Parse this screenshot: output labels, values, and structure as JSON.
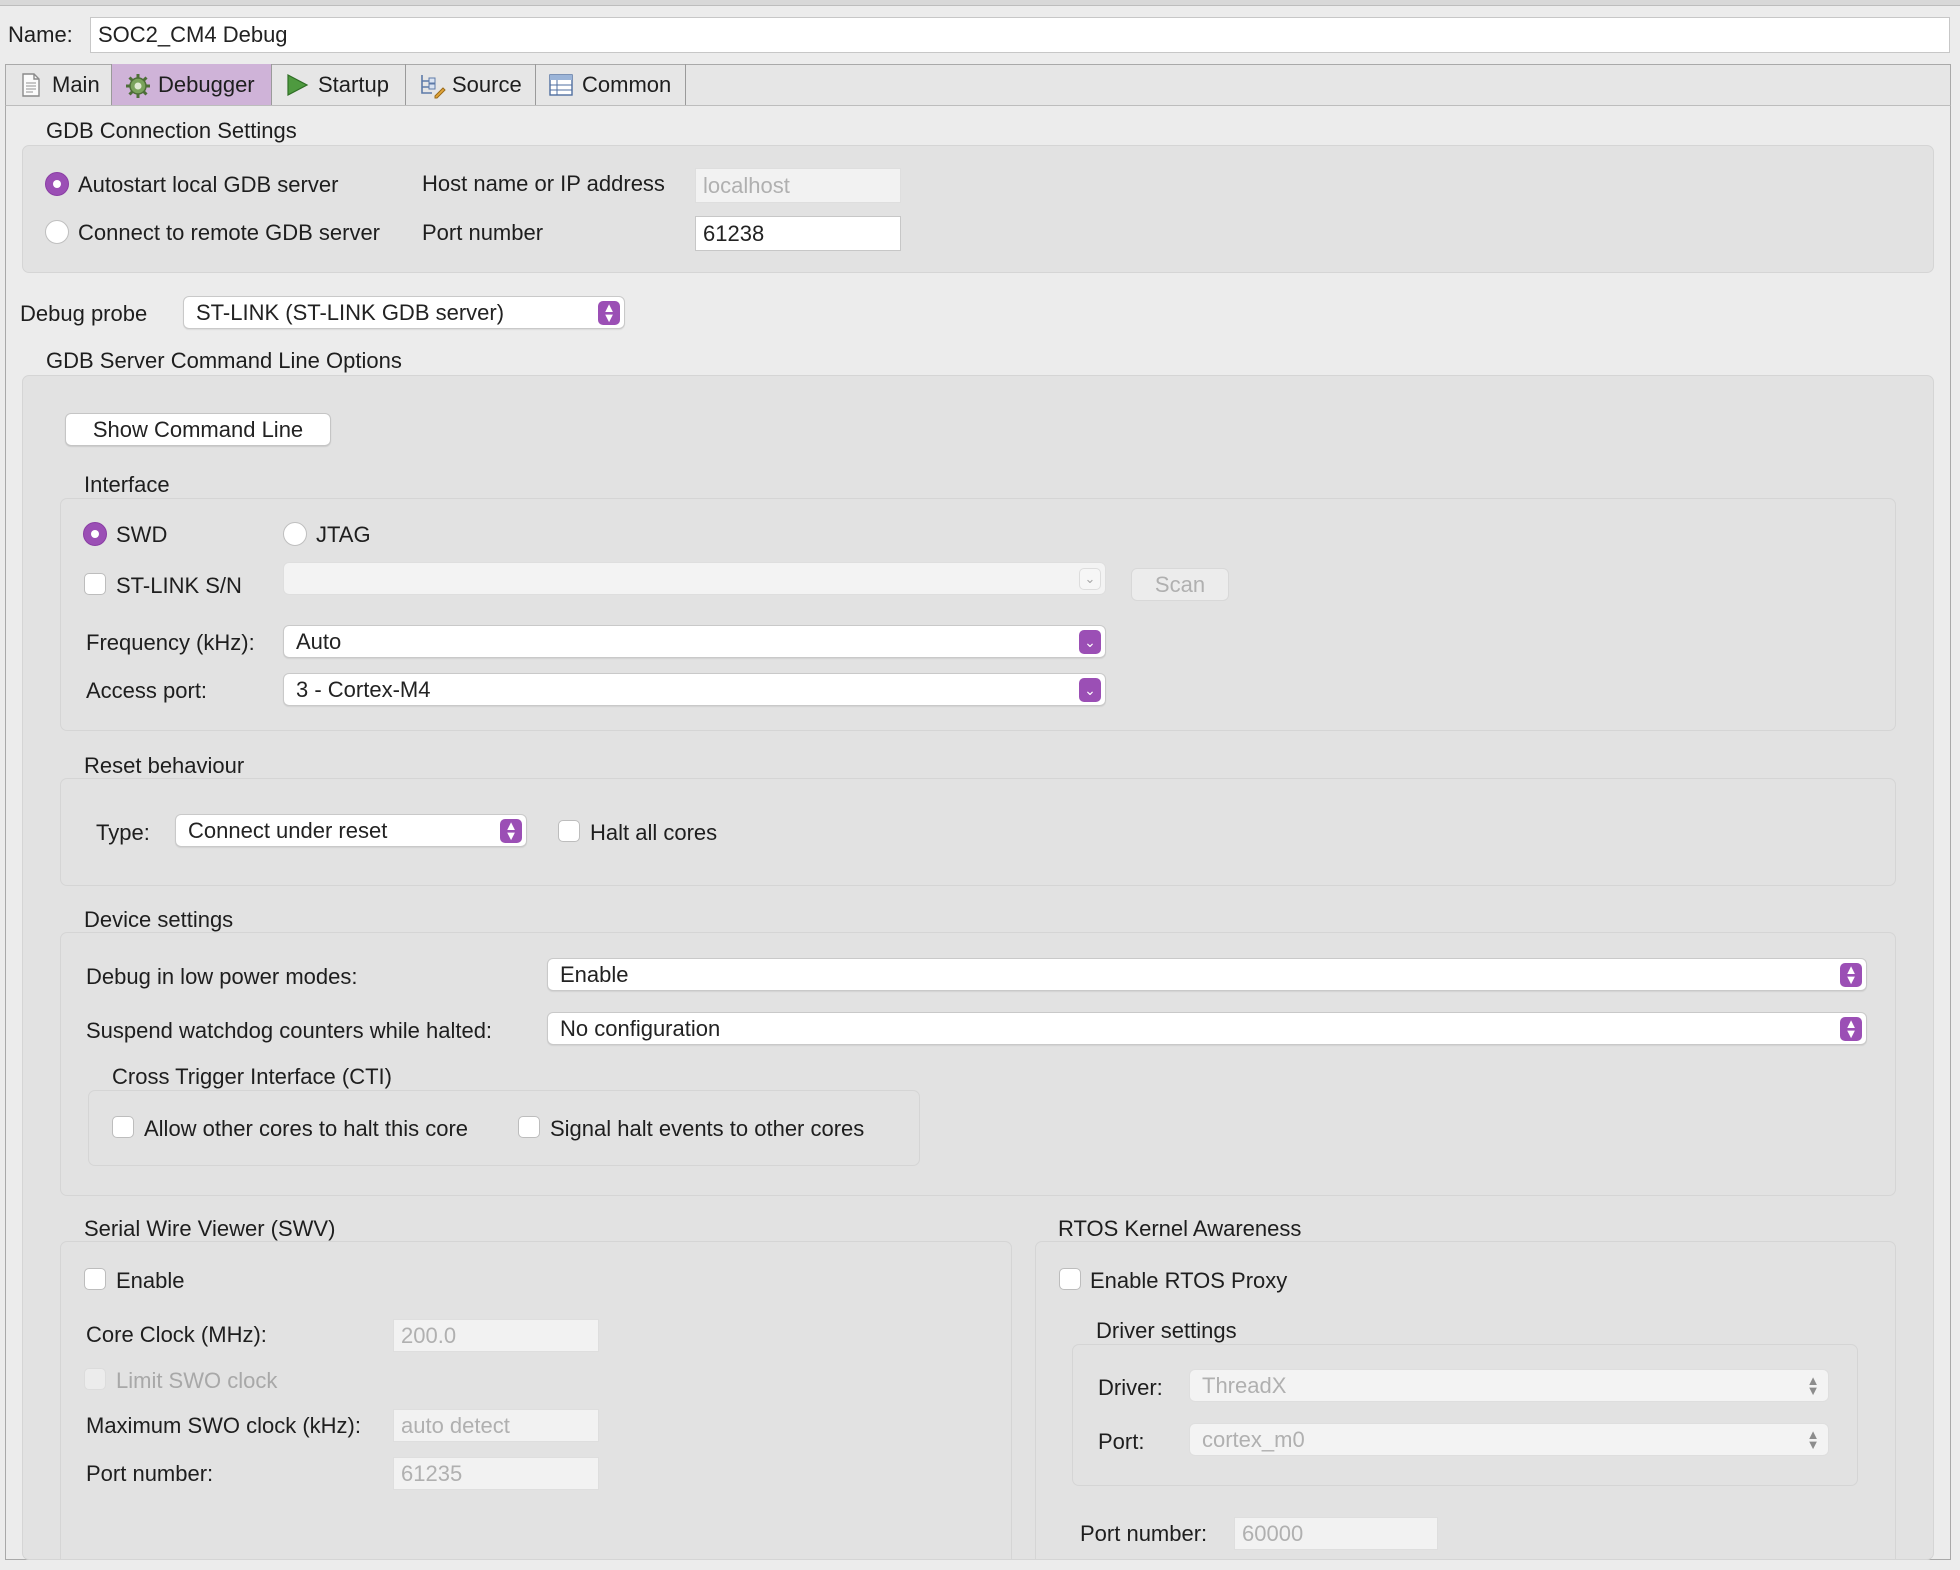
{
  "name_label": "Name:",
  "name_value": "SOC2_CM4 Debug",
  "tabs": [
    {
      "label": "Main",
      "icon": "document-icon"
    },
    {
      "label": "Debugger",
      "icon": "bug-gear-icon"
    },
    {
      "label": "Startup",
      "icon": "play-icon"
    },
    {
      "label": "Source",
      "icon": "source-lookup-icon"
    },
    {
      "label": "Common",
      "icon": "table-icon"
    }
  ],
  "gdb_connection": {
    "title": "GDB Connection Settings",
    "autostart_label": "Autostart local GDB server",
    "remote_label": "Connect to remote GDB server",
    "host_label": "Host name or IP address",
    "host_value": "localhost",
    "port_label": "Port number",
    "port_value": "61238"
  },
  "debug_probe": {
    "label": "Debug probe",
    "value": "ST-LINK (ST-LINK GDB server)"
  },
  "gdb_server_options": {
    "title": "GDB Server Command Line Options",
    "show_command_line": "Show Command Line"
  },
  "interface": {
    "title": "Interface",
    "swd_label": "SWD",
    "jtag_label": "JTAG",
    "stlink_sn_label": "ST-LINK S/N",
    "stlink_sn_value": "",
    "scan_label": "Scan",
    "frequency_label": "Frequency (kHz):",
    "frequency_value": "Auto",
    "access_port_label": "Access port:",
    "access_port_value": "3 - Cortex-M4"
  },
  "reset": {
    "title": "Reset behaviour",
    "type_label": "Type:",
    "type_value": "Connect under reset",
    "halt_all_label": "Halt all cores"
  },
  "device": {
    "title": "Device settings",
    "low_power_label": "Debug in low power modes:",
    "low_power_value": "Enable",
    "watchdog_label": "Suspend watchdog counters while halted:",
    "watchdog_value": "No configuration",
    "cti_title": "Cross Trigger Interface (CTI)",
    "allow_halt_label": "Allow other cores to halt this core",
    "signal_halt_label": "Signal halt events to other cores"
  },
  "swv": {
    "title": "Serial Wire Viewer (SWV)",
    "enable_label": "Enable",
    "core_clock_label": "Core Clock (MHz):",
    "core_clock_value": "200.0",
    "limit_swo_label": "Limit SWO clock",
    "max_swo_label": "Maximum SWO clock (kHz):",
    "max_swo_value": "auto detect",
    "port_label": "Port number:",
    "port_value": "61235"
  },
  "rtos": {
    "title": "RTOS Kernel Awareness",
    "enable_proxy_label": "Enable RTOS Proxy",
    "driver_settings_title": "Driver settings",
    "driver_label": "Driver:",
    "driver_value": "ThreadX",
    "port_label": "Port:",
    "port_value": "cortex_m0",
    "port_number_label": "Port number:",
    "port_number_value": "60000"
  },
  "colors": {
    "accent": "#9b4fb5",
    "active_tab": "#cfb3d8",
    "window_bg": "#ececec",
    "group_bg": "#e2e2e2"
  }
}
